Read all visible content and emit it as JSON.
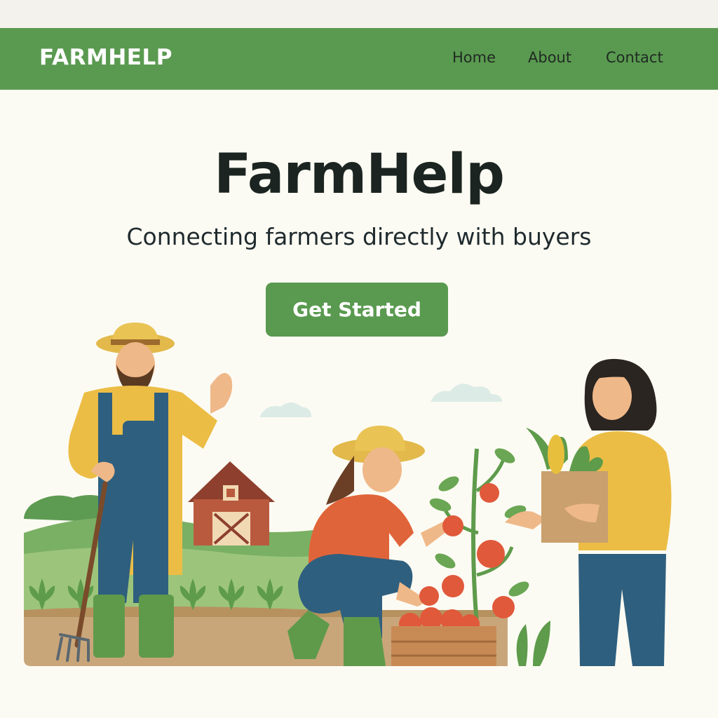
{
  "nav": {
    "brand": "FARMHELP",
    "links": [
      {
        "label": "Home"
      },
      {
        "label": "About"
      },
      {
        "label": "Contact"
      }
    ]
  },
  "hero": {
    "title": "FarmHelp",
    "subtitle": "Connecting farmers directly with buyers",
    "cta_label": "Get Started"
  },
  "colors": {
    "brand_green": "#5a9a50",
    "background": "#fcfbf3",
    "heading": "#1b2420"
  },
  "illustration": {
    "icons": [
      "farmer-man-illustration",
      "barn-illustration",
      "farmer-woman-illustration",
      "tomato-plant-illustration",
      "buyer-woman-illustration",
      "cloud-icon"
    ]
  }
}
